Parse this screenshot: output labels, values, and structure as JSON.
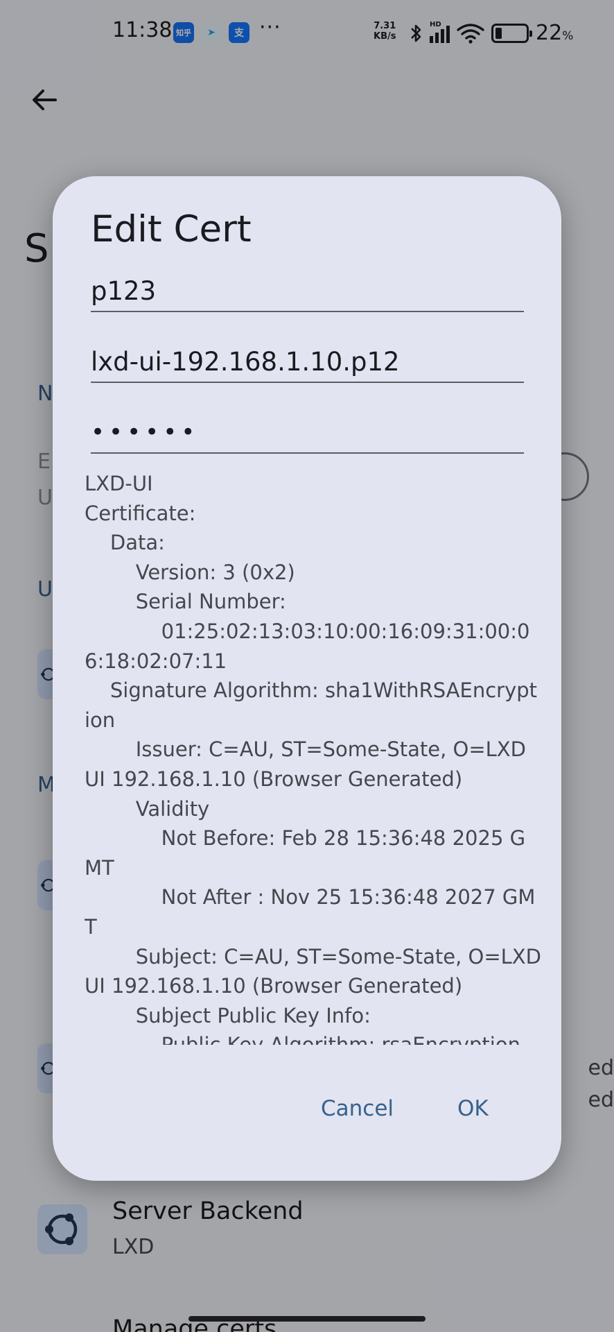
{
  "status_bar": {
    "time": "11:38",
    "app_icons": [
      {
        "name": "zhihu-icon",
        "glyph": "知乎",
        "color": "#1772f6"
      },
      {
        "name": "telegram-icon",
        "glyph": "➤",
        "color": "#2aa3e4"
      },
      {
        "name": "alipay-icon",
        "glyph": "支",
        "color": "#1677ff"
      }
    ],
    "more": "···",
    "net_speed_value": "7.31",
    "net_speed_unit": "KB/s",
    "signal_label": "HD",
    "battery_percent": 22,
    "battery_label": "22",
    "battery_unit": "%"
  },
  "background": {
    "page_title": "S",
    "sections": [
      {
        "label": "N"
      },
      {
        "label": "U"
      },
      {
        "label": "M"
      }
    ],
    "muted_lines": [
      "E",
      "U"
    ],
    "right_edge_lines": [
      "ed",
      "ed"
    ],
    "server_backend": {
      "title": "Server Backend",
      "value": "LXD"
    },
    "manage_certs_label": "Manage certs"
  },
  "dialog": {
    "title": "Edit Cert",
    "name_value": "p123",
    "file_value": "lxd-ui-192.168.1.10.p12",
    "password_value": "••••••",
    "cert_text": "LXD-UI\nCertificate:\n    Data:\n        Version: 3 (0x2)\n        Serial Number:\n            01:25:02:13:03:10:00:16:09:31:00:06:18:02:07:11\n    Signature Algorithm: sha1WithRSAEncryption\n        Issuer: C=AU, ST=Some-State, O=LXD UI 192.168.1.10 (Browser Generated)\n        Validity\n            Not Before: Feb 28 15:36:48 2025 GMT\n            Not After : Nov 25 15:36:48 2027 GMT\n        Subject: C=AU, ST=Some-State, O=LXD UI 192.168.1.10 (Browser Generated)\n        Subject Public Key Info:\n            Public Key Algorithm: rsaEncryption",
    "cancel_label": "Cancel",
    "ok_label": "OK"
  },
  "colors": {
    "accent": "#36618e",
    "dialog_surface": "#e2e4f1",
    "icon_container": "#d3e4ff",
    "scrim": "rgba(0,0,0,0.32)"
  }
}
